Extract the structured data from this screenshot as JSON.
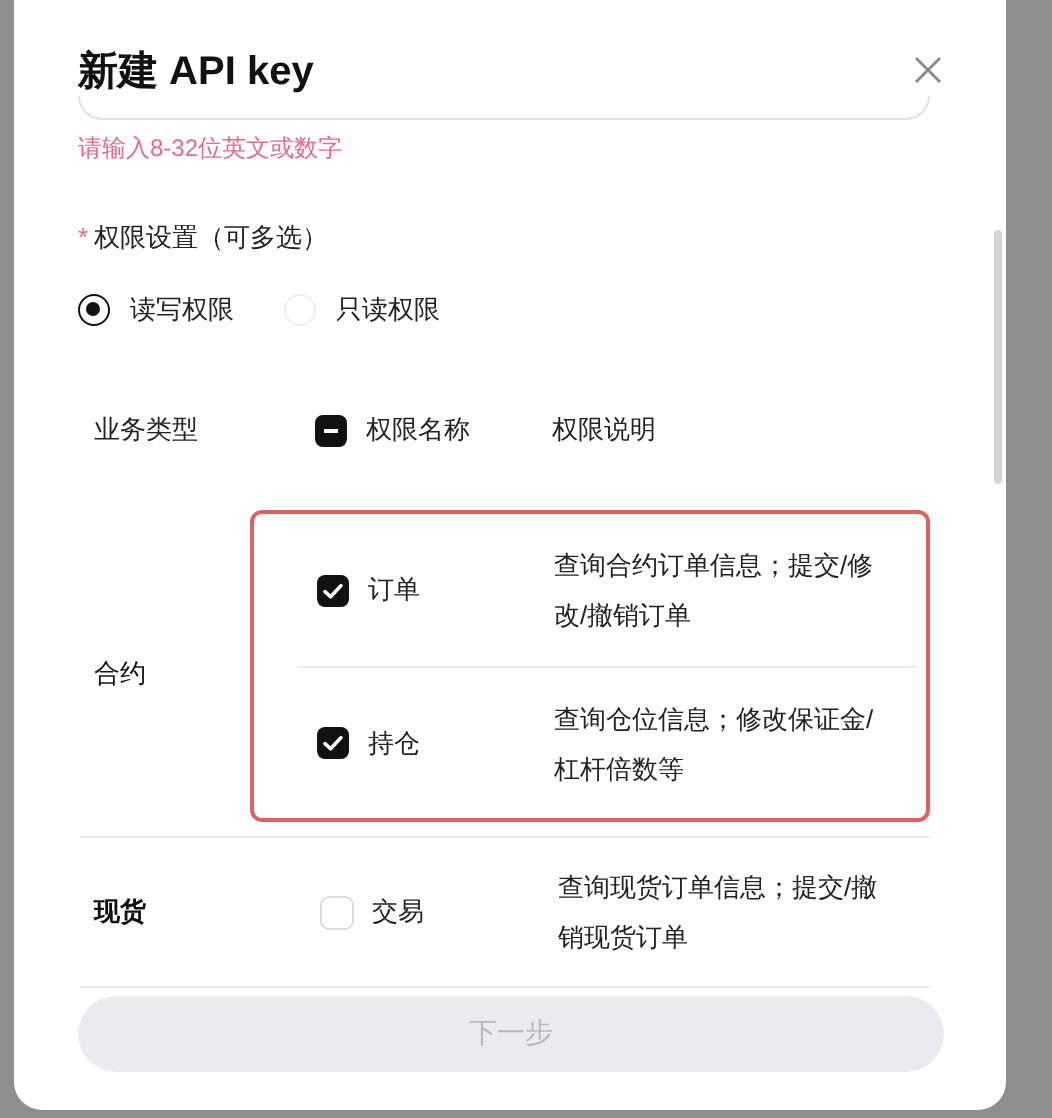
{
  "dialog": {
    "title": "新建 API key",
    "field_error": "请输入8-32位英文或数字",
    "permission_label": {
      "required_mark": "*",
      "text": "权限设置（可多选）"
    },
    "modes": [
      {
        "label": "读写权限",
        "selected": true
      },
      {
        "label": "只读权限",
        "selected": false
      }
    ],
    "table": {
      "columns": [
        "业务类型",
        "权限名称",
        "权限说明"
      ],
      "select_all": {
        "checked": false,
        "indeterminate": true
      },
      "groups": [
        {
          "type": "合约",
          "highlighted": true,
          "rows": [
            {
              "name": "订单",
              "description": "查询合约订单信息；提交/修改/撤销订单",
              "checked": true
            },
            {
              "name": "持仓",
              "description": "查询仓位信息；修改保证金/杠杆倍数等",
              "checked": true
            }
          ]
        },
        {
          "type": "现货",
          "highlighted": false,
          "rows": [
            {
              "name": "交易",
              "description": "查询现货订单信息；提交/撤销现货订单",
              "checked": false
            }
          ]
        }
      ]
    },
    "next_button": {
      "label": "下一步",
      "disabled": true
    }
  }
}
